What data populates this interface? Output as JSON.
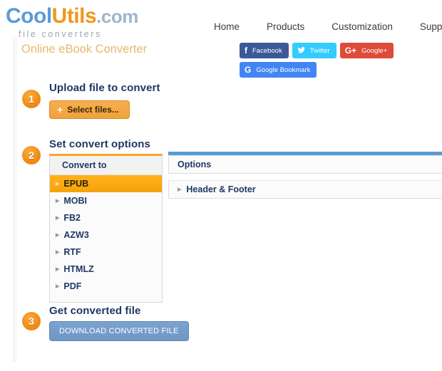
{
  "brand": {
    "logo_cool": "Cool",
    "logo_utils": "Utils",
    "logo_com": ".com",
    "tagline": "file converters"
  },
  "nav": {
    "items": [
      {
        "label": "Home"
      },
      {
        "label": "Products"
      },
      {
        "label": "Customization"
      },
      {
        "label": "Suppo"
      }
    ]
  },
  "social": {
    "buttons": [
      {
        "label": "Facebook",
        "glyph": "f",
        "icon": "facebook-icon",
        "color": "#3b5998"
      },
      {
        "label": "Twitter",
        "glyph": "❈",
        "icon": "twitter-icon",
        "color": "#33ccff"
      },
      {
        "label": "Google+",
        "glyph": "G+",
        "icon": "googleplus-icon",
        "color": "#dd4b39"
      },
      {
        "label": "Google Bookmark",
        "glyph": "G",
        "icon": "google-icon",
        "color": "#4285f4"
      }
    ]
  },
  "page": {
    "title": "Online eBook Converter",
    "title_color": "#e8b96a"
  },
  "steps": {
    "one": {
      "number": "1",
      "heading": "Upload file to convert",
      "button_label": "Select files...",
      "button_plus": "+"
    },
    "two": {
      "number": "2",
      "heading": "Set convert options",
      "convert_to_label": "Convert to",
      "formats": [
        {
          "label": "EPUB",
          "selected": true
        },
        {
          "label": "MOBI",
          "selected": false
        },
        {
          "label": "FB2",
          "selected": false
        },
        {
          "label": "AZW3",
          "selected": false
        },
        {
          "label": "RTF",
          "selected": false
        },
        {
          "label": "HTMLZ",
          "selected": false
        },
        {
          "label": "PDF",
          "selected": false
        }
      ],
      "options_label": "Options",
      "header_footer_label": "Header & Footer"
    },
    "three": {
      "number": "3",
      "heading": "Get converted file",
      "button_label": "DOWNLOAD CONVERTED FILE"
    }
  }
}
